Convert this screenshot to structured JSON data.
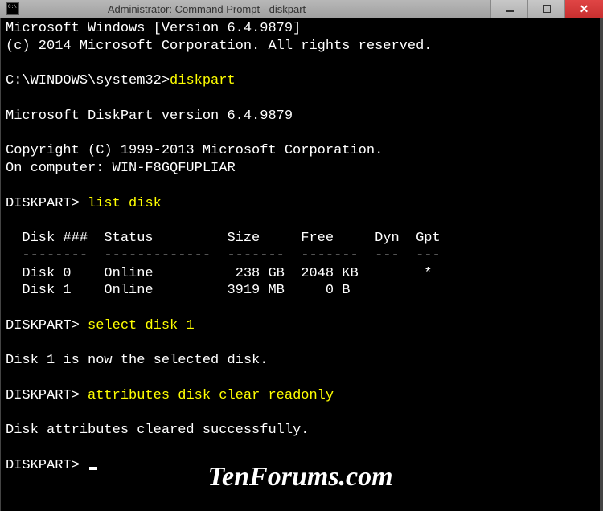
{
  "titlebar": {
    "title": "Administrator: Command Prompt - diskpart"
  },
  "terminal": {
    "line1": "Microsoft Windows [Version 6.4.9879]",
    "line2": "(c) 2014 Microsoft Corporation. All rights reserved.",
    "prompt1_path": "C:\\WINDOWS\\system32>",
    "prompt1_cmd": "diskpart",
    "dp_version": "Microsoft DiskPart version 6.4.9879",
    "dp_copyright": "Copyright (C) 1999-2013 Microsoft Corporation.",
    "dp_computer": "On computer: WIN-F8GQFUPLIAR",
    "dp_prompt": "DISKPART> ",
    "cmd_list": "list disk",
    "table_header": "  Disk ###  Status         Size     Free     Dyn  Gpt",
    "table_rule": "  --------  -------------  -------  -------  ---  ---",
    "table_row0": "  Disk 0    Online          238 GB  2048 KB        *",
    "table_row1": "  Disk 1    Online         3919 MB     0 B",
    "cmd_select": "select disk 1",
    "msg_selected": "Disk 1 is now the selected disk.",
    "cmd_attr": "attributes disk clear readonly",
    "msg_cleared": "Disk attributes cleared successfully."
  },
  "watermark": "TenForums.com"
}
